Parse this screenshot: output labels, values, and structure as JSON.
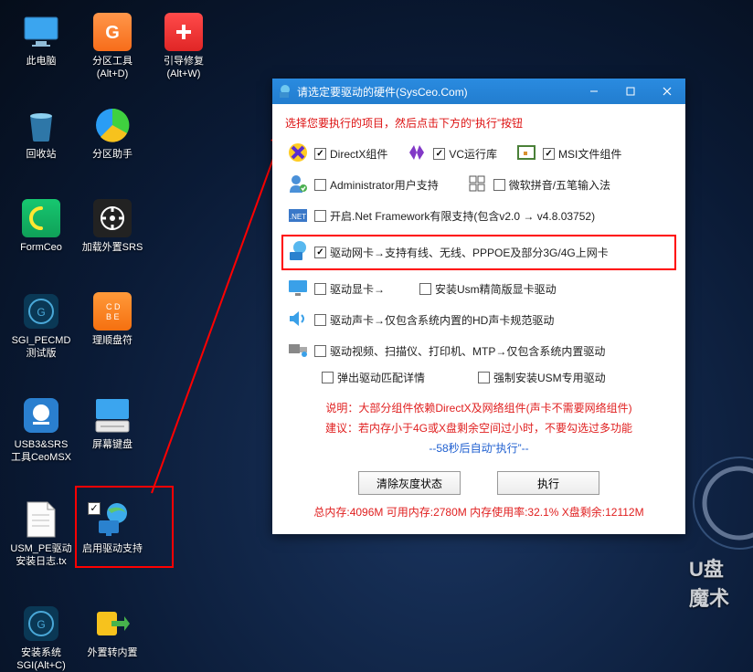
{
  "desktop": {
    "icons": [
      {
        "label": "此电脑"
      },
      {
        "label": "分区工具\n(Alt+D)"
      },
      {
        "label": "引导修复\n(Alt+W)"
      },
      {
        "label": "回收站"
      },
      {
        "label": "分区助手"
      },
      {
        "label": "FormCeo"
      },
      {
        "label": "加载外置SRS"
      },
      {
        "label": "SGI_PECMD\n测试版"
      },
      {
        "label": "理顺盘符"
      },
      {
        "label": "USB3&SRS\n工具CeoMSX"
      },
      {
        "label": "屏幕键盘"
      },
      {
        "label": "USM_PE驱动\n安装日志.tx"
      },
      {
        "label": "启用驱动支持"
      },
      {
        "label": "安装系统\nSGI(Alt+C)"
      },
      {
        "label": "外置转内置"
      }
    ]
  },
  "dialog": {
    "title": "请选定要驱动的硬件(SysCeo.Com)",
    "instruction": "选择您要执行的项目，然后点击下方的“执行”按钮",
    "row1": {
      "a": "DirectX组件",
      "b": "VC运行库",
      "c": "MSI文件组件"
    },
    "row2": {
      "a": "Administrator用户支持",
      "b": "微软拼音/五笔输入法"
    },
    "row3": {
      "label": "开启.Net Framework有限支持(包含v2.0 → v4.8.03752)"
    },
    "row4": {
      "label": "驱动网卡→支持有线、无线、PPPOE及部分3G/4G上网卡"
    },
    "row5": {
      "a": "驱动显卡→",
      "b": "安装Usm精简版显卡驱动"
    },
    "row6": {
      "label": "驱动声卡→仅包含系统内置的HD声卡规范驱动"
    },
    "row7": {
      "label": "驱动视频、扫描仪、打印机、MTP→仅包含系统内置驱动"
    },
    "row8": {
      "a": "弹出驱动匹配详情",
      "b": "强制安装USM专用驱动"
    },
    "notes": {
      "l1": "说明：大部分组件依赖DirectX及网络组件(声卡不需要网络组件)",
      "l2": "建议：若内存小于4G或X盘剩余空间过小时，不要勾选过多功能",
      "l3_pre": "--",
      "l3_count": "58秒后自动“执行”",
      "l3_post": "--"
    },
    "buttons": {
      "clear": "清除灰度状态",
      "run": "执行"
    },
    "status": "总内存:4096M  可用内存:2780M  内存使用率:32.1%  X盘剩余:12112M"
  },
  "bg_text": "U盘\n魔术"
}
